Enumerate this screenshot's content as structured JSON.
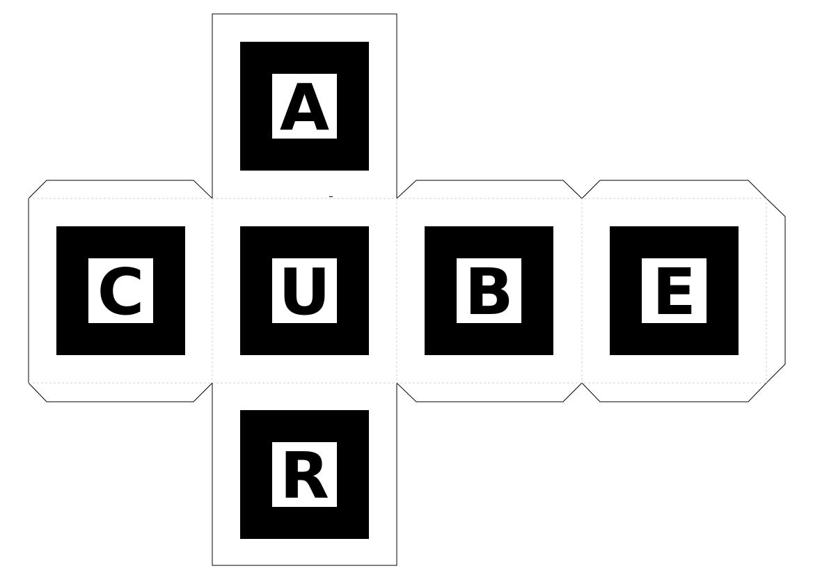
{
  "net": {
    "faces": [
      {
        "id": "top",
        "letter": "A"
      },
      {
        "id": "left",
        "letter": "C"
      },
      {
        "id": "front",
        "letter": "U"
      },
      {
        "id": "right",
        "letter": "B"
      },
      {
        "id": "back",
        "letter": "E"
      },
      {
        "id": "bottom",
        "letter": "R"
      }
    ]
  },
  "colors": {
    "marker": "#000000",
    "paper": "#ffffff",
    "cut_line": "#000000",
    "fold_line": "#cfcfcf"
  }
}
